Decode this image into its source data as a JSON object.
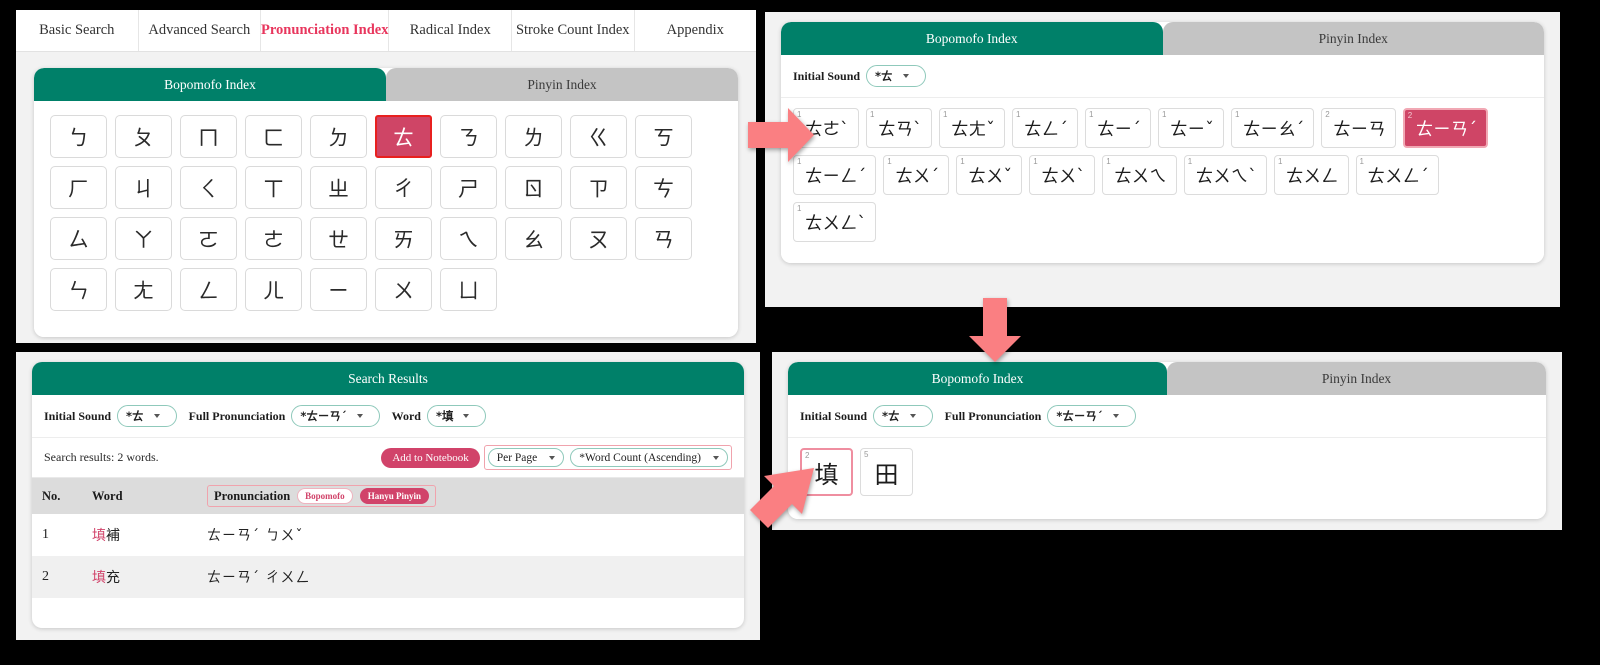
{
  "nav": {
    "tabs": [
      {
        "label": "Basic Search",
        "active": false
      },
      {
        "label": "Advanced Search",
        "active": false
      },
      {
        "label": "Pronunciation Index",
        "active": true
      },
      {
        "label": "Radical Index",
        "active": false
      },
      {
        "label": "Stroke Count Index",
        "active": false
      },
      {
        "label": "Appendix",
        "active": false
      }
    ]
  },
  "index_tabs": {
    "bopomofo": "Bopomofo Index",
    "pinyin": "Pinyin Index"
  },
  "panel_initial": {
    "keys": [
      [
        "ㄅ",
        "ㄆ",
        "ㄇ",
        "ㄈ",
        "ㄉ",
        "ㄊ",
        "ㄋ",
        "ㄌ",
        "ㄍ",
        "ㄎ"
      ],
      [
        "ㄏ",
        "ㄐ",
        "ㄑ",
        "ㄒ",
        "ㄓ",
        "ㄔ",
        "ㄕ",
        "ㄖ",
        "ㄗ",
        "ㄘ"
      ],
      [
        "ㄙ",
        "ㄚ",
        "ㄛ",
        "ㄜ",
        "ㄝ",
        "ㄞ",
        "ㄟ",
        "ㄠ",
        "ㄡ",
        "ㄢ"
      ],
      [
        "ㄣ",
        "ㄤ",
        "ㄥ",
        "ㄦ",
        "ㄧ",
        "ㄨ",
        "ㄩ"
      ]
    ],
    "selected_key": "ㄊ"
  },
  "panel_pronunciation": {
    "filters": [
      {
        "label": "Initial Sound",
        "value": "*ㄊ"
      }
    ],
    "tiles": [
      [
        {
          "sup": "1",
          "text": "ㄊㄜˋ",
          "selected": false
        },
        {
          "sup": "1",
          "text": "ㄊㄢˋ",
          "selected": false
        },
        {
          "sup": "1",
          "text": "ㄊㄤˇ",
          "selected": false
        },
        {
          "sup": "1",
          "text": "ㄊㄥˊ",
          "selected": false
        },
        {
          "sup": "1",
          "text": "ㄊㄧˊ",
          "selected": false
        },
        {
          "sup": "1",
          "text": "ㄊㄧˇ",
          "selected": false
        },
        {
          "sup": "1",
          "text": "ㄊㄧㄠˊ",
          "selected": false
        },
        {
          "sup": "2",
          "text": "ㄊㄧㄢ",
          "selected": false
        },
        {
          "sup": "2",
          "text": "ㄊㄧㄢˊ",
          "selected": true
        }
      ],
      [
        {
          "sup": "1",
          "text": "ㄊㄧㄥˊ",
          "selected": false
        },
        {
          "sup": "1",
          "text": "ㄊㄨˊ",
          "selected": false
        },
        {
          "sup": "1",
          "text": "ㄊㄨˇ",
          "selected": false
        },
        {
          "sup": "1",
          "text": "ㄊㄨˋ",
          "selected": false
        },
        {
          "sup": "1",
          "text": "ㄊㄨㄟ",
          "selected": false
        },
        {
          "sup": "1",
          "text": "ㄊㄨㄟˋ",
          "selected": false
        },
        {
          "sup": "1",
          "text": "ㄊㄨㄥ",
          "selected": false
        },
        {
          "sup": "1",
          "text": "ㄊㄨㄥˊ",
          "selected": false
        }
      ],
      [
        {
          "sup": "1",
          "text": "ㄊㄨㄥˋ",
          "selected": false
        }
      ]
    ]
  },
  "panel_word": {
    "filters": [
      {
        "label": "Initial Sound",
        "value": "*ㄊ"
      },
      {
        "label": "Full Pronunciation",
        "value": "*ㄊㄧㄢˊ"
      }
    ],
    "tiles": [
      {
        "sup": "2",
        "text": "填",
        "selected": true
      },
      {
        "sup": "5",
        "text": "田",
        "selected": false
      }
    ]
  },
  "search_results": {
    "title": "Search Results",
    "filters": [
      {
        "label": "Initial Sound",
        "value": "*ㄊ"
      },
      {
        "label": "Full Pronunciation",
        "value": "*ㄊㄧㄢˊ"
      },
      {
        "label": "Word",
        "value": "*填"
      }
    ],
    "count_text": "Search results: 2 words.",
    "add_to_notebook": "Add to Notebook",
    "per_page": "Per Page",
    "sort_order": "*Word Count (Ascending)",
    "columns": {
      "no": "No.",
      "word": "Word",
      "pronunciation": "Pronunciation",
      "badge_bopomofo": "Bopomofo",
      "badge_pinyin": "Hanyu Pinyin"
    },
    "rows": [
      {
        "no": "1",
        "word_hl": "填",
        "word_rest": "補",
        "bopomofo": "ㄊㄧㄢˊ ㄅㄨˇ"
      },
      {
        "no": "2",
        "word_hl": "填",
        "word_rest": "充",
        "bopomofo": "ㄊㄧㄢˊ ㄔㄨㄥ"
      }
    ]
  },
  "colors": {
    "teal": "#008069",
    "accent_red": "#d1436a",
    "nav_active": "#e8365d",
    "arrow": "#fa7f82",
    "tab_inactive": "#c4c4c4"
  },
  "arrows": [
    {
      "name": "arrow-right-to-pronunciation",
      "direction": "right"
    },
    {
      "name": "arrow-down-to-word",
      "direction": "down"
    },
    {
      "name": "arrow-down-left-to-results",
      "direction": "down-left"
    }
  ]
}
